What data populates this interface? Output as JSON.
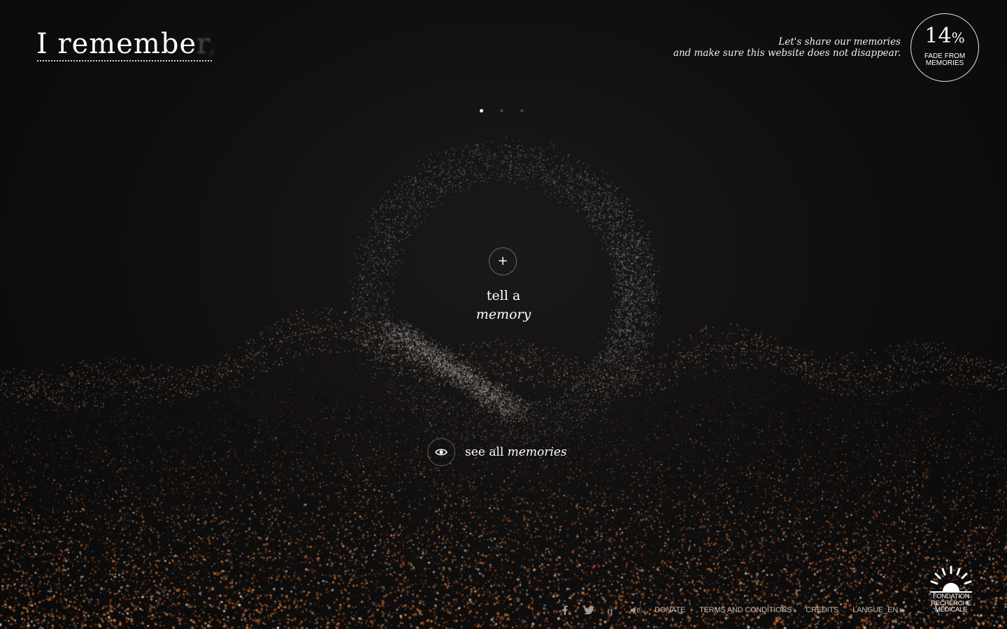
{
  "header": {
    "title_visible": "I remembe",
    "title_fading_1": "r",
    "title_fading_2": ","
  },
  "campaign": {
    "tagline_line1": "Let's share our memories",
    "tagline_line2": "and make sure this website does not disappear.",
    "fade_number": "14",
    "fade_percent_sign": "%",
    "fade_label_line1": "FADE FROM",
    "fade_label_line2": "MEMORIES"
  },
  "pager": {
    "count": 3,
    "active_index": 0
  },
  "main": {
    "tell_button_symbol": "+",
    "tell_line1": "tell a",
    "tell_line2": "memory",
    "see_all_prefix": "see all ",
    "see_all_em": "memories"
  },
  "footer": {
    "links": [
      "DONATE",
      "TERMS AND CONDITIONS",
      "CREDITS",
      "LANGUE_EN"
    ],
    "icons": [
      "facebook-icon",
      "twitter-icon",
      "google-plus-icon",
      "sound-icon"
    ]
  },
  "brand": {
    "line1": "FONDATION",
    "line2": "RECHERCHE",
    "line3": "MÉDICALE"
  },
  "colors": {
    "background": "#0d0c0c",
    "text": "#f2efe9",
    "particle_warm": "#d98a3c",
    "particle_light": "#f4d6a8",
    "ring_particles": "#cfcac4"
  }
}
